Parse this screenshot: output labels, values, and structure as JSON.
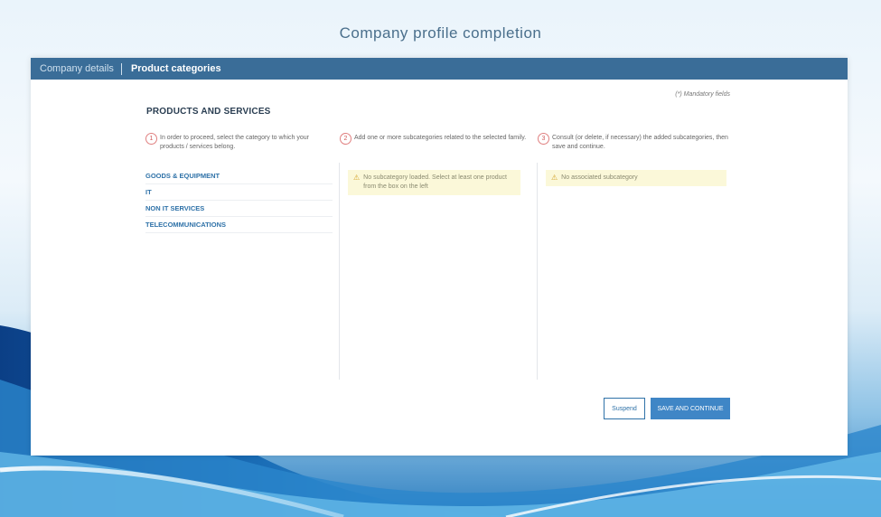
{
  "page": {
    "title": "Company profile completion"
  },
  "tabs": [
    {
      "label": "Company details"
    },
    {
      "label": "Product categories"
    }
  ],
  "mandatory_note": "(*) Mandatory fields",
  "section_title": "PRODUCTS AND SERVICES",
  "steps": [
    {
      "num": "1",
      "text": "In order to proceed, select the category to which your products / services belong."
    },
    {
      "num": "2",
      "text": "Add one or more subcategories related to the selected family."
    },
    {
      "num": "3",
      "text": "Consult (or delete, if necessary) the added subcategories, then save and continue."
    }
  ],
  "categories": [
    {
      "label": "GOODS & EQUIPMENT"
    },
    {
      "label": "IT"
    },
    {
      "label": "NON IT SERVICES"
    },
    {
      "label": "TELECOMMUNICATIONS"
    }
  ],
  "warnings": {
    "subcategory_none_loaded": "No subcategory loaded. Select at least one product from the box on the left",
    "no_associated": "No associated subcategory",
    "icon": "warning-triangle-icon",
    "color": "#fbf8d9"
  },
  "buttons": {
    "suspend": "Suspend",
    "save_continue": "SAVE AND CONTINUE"
  },
  "colors": {
    "tabbar": "#3a6d98",
    "accent": "#2f72a8",
    "primary_button": "#3f86c6",
    "step_circle": "#e08080"
  }
}
